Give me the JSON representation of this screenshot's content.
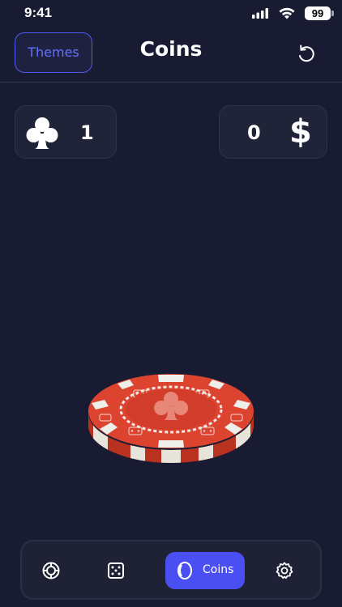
{
  "status_bar": {
    "time": "9:41",
    "battery": "99",
    "icons": [
      "cellular-signal-icon",
      "wifi-icon",
      "battery-icon"
    ]
  },
  "header": {
    "themes_label": "Themes",
    "title": "Coins",
    "reset_icon": "reset-icon"
  },
  "counters": {
    "clubs": {
      "icon": "club-icon",
      "value": "1"
    },
    "dollars": {
      "value": "0",
      "symbol": "$"
    }
  },
  "coin": {
    "icon": "poker-chip-icon",
    "face": "club"
  },
  "nav": {
    "items": [
      {
        "icon": "poker-chip-icon",
        "label": "",
        "active": false
      },
      {
        "icon": "dice-icon",
        "label": "",
        "active": false
      },
      {
        "icon": "coin-icon",
        "label": "Coins",
        "active": true
      },
      {
        "icon": "gear-icon",
        "label": "",
        "active": false
      }
    ]
  },
  "colors": {
    "background": "#181b31",
    "accent": "#4a4ff2",
    "chip_red": "#d8412f",
    "chip_white": "#eeeeea"
  }
}
